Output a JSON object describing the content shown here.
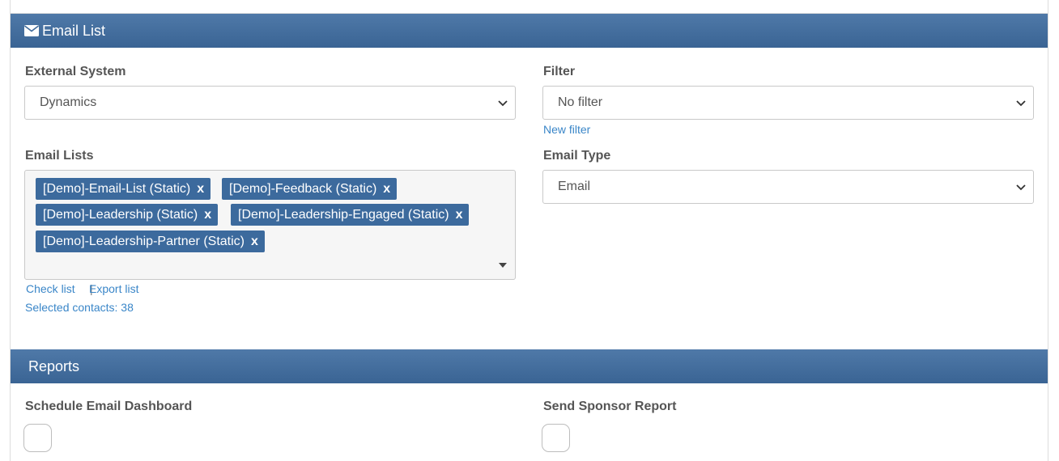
{
  "email_panel": {
    "title": "Email List",
    "external_system": {
      "label": "External System",
      "value": "Dynamics"
    },
    "filter": {
      "label": "Filter",
      "value": "No filter",
      "new_filter_link": "New filter"
    },
    "email_lists": {
      "label": "Email Lists",
      "tags": [
        "[Demo]-Email-List (Static)",
        "[Demo]-Feedback (Static)",
        "[Demo]-Leadership (Static)",
        "[Demo]-Leadership-Engaged (Static)",
        "[Demo]-Leadership-Partner (Static)"
      ],
      "remove_glyph": "x",
      "check_list_link": "Check list",
      "separator": "|",
      "export_list_link": "Export list",
      "selected_contacts": "Selected contacts: 38"
    },
    "email_type": {
      "label": "Email Type",
      "value": "Email"
    }
  },
  "reports_panel": {
    "title": "Reports",
    "schedule_email_dashboard": {
      "label": "Schedule Email Dashboard",
      "checked": false
    },
    "send_sponsor_report": {
      "label": "Send Sponsor Report",
      "checked": false
    }
  },
  "colors": {
    "header_top": "#4f79a8",
    "header_bottom": "#3a6494",
    "tag_bg": "#3c6a9d",
    "link": "#3a86c8"
  }
}
